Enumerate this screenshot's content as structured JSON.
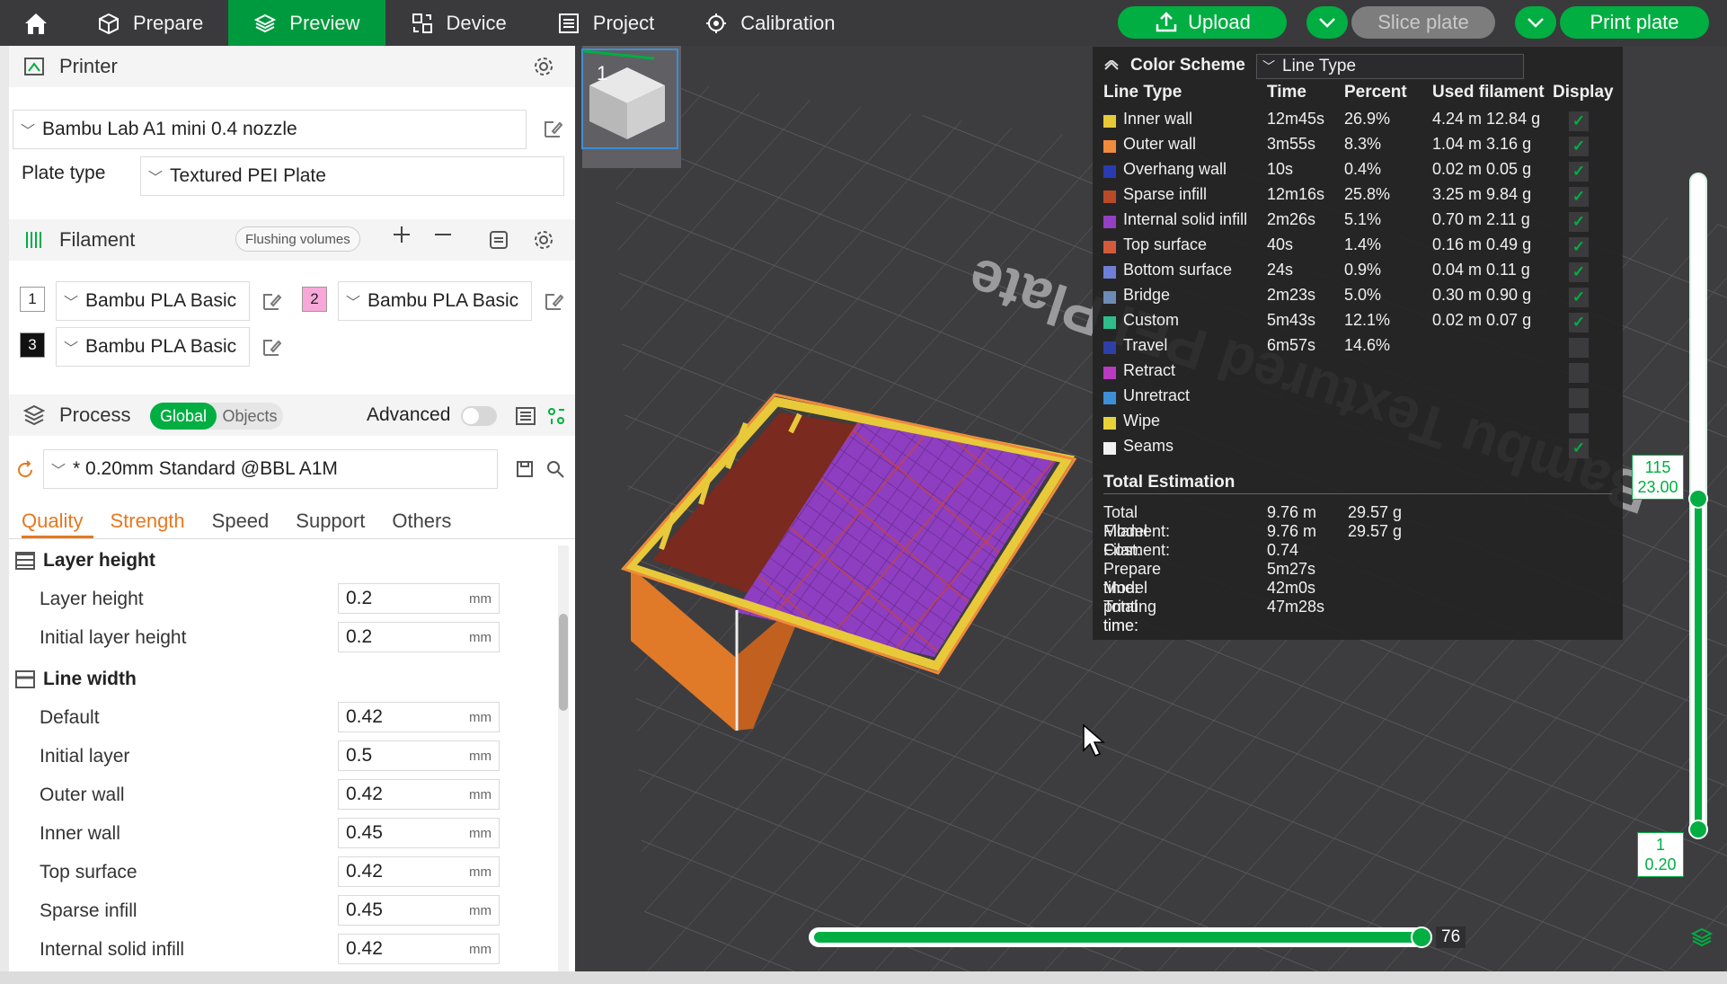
{
  "topbar": {
    "tabs": [
      {
        "label": "Prepare",
        "icon": "cube-icon"
      },
      {
        "label": "Preview",
        "icon": "layers-icon",
        "active": true
      },
      {
        "label": "Device",
        "icon": "device-icon"
      },
      {
        "label": "Project",
        "icon": "project-icon"
      },
      {
        "label": "Calibration",
        "icon": "calibration-icon"
      }
    ],
    "upload_label": "Upload",
    "slice_label": "Slice plate",
    "print_label": "Print plate"
  },
  "printer": {
    "title": "Printer",
    "name": "Bambu Lab A1 mini 0.4 nozzle",
    "plate_type_label": "Plate type",
    "plate_type_value": "Textured PEI Plate"
  },
  "filament": {
    "title": "Filament",
    "flushing_label": "Flushing volumes",
    "slots": [
      {
        "num": "1",
        "name": "Bambu PLA Basic",
        "color": "#ffffff",
        "text_color": "#222222"
      },
      {
        "num": "2",
        "name": "Bambu PLA Basic",
        "color": "#f7a8d8",
        "text_color": "#222222"
      },
      {
        "num": "3",
        "name": "Bambu PLA Basic",
        "color": "#111111",
        "text_color": "#ffffff"
      }
    ]
  },
  "process": {
    "title": "Process",
    "global_label": "Global",
    "objects_label": "Objects",
    "advanced_label": "Advanced",
    "preset": "* 0.20mm Standard @BBL A1M",
    "tabs": [
      "Quality",
      "Strength",
      "Speed",
      "Support",
      "Others"
    ],
    "groups": {
      "layer_height": {
        "title": "Layer height",
        "params": [
          {
            "label": "Layer height",
            "value": "0.2",
            "unit": "mm"
          },
          {
            "label": "Initial layer height",
            "value": "0.2",
            "unit": "mm"
          }
        ]
      },
      "line_width": {
        "title": "Line width",
        "params": [
          {
            "label": "Default",
            "value": "0.42",
            "unit": "mm"
          },
          {
            "label": "Initial layer",
            "value": "0.5",
            "unit": "mm"
          },
          {
            "label": "Outer wall",
            "value": "0.42",
            "unit": "mm"
          },
          {
            "label": "Inner wall",
            "value": "0.45",
            "unit": "mm"
          },
          {
            "label": "Top surface",
            "value": "0.42",
            "unit": "mm"
          },
          {
            "label": "Sparse infill",
            "value": "0.45",
            "unit": "mm"
          },
          {
            "label": "Internal solid infill",
            "value": "0.42",
            "unit": "mm"
          }
        ]
      }
    }
  },
  "viewport": {
    "plate_number": "1",
    "plate_text": "Bambu Textured PEI Plate",
    "legend": {
      "title": "Color Scheme",
      "scheme": "Line Type",
      "columns": [
        "Line Type",
        "Time",
        "Percent",
        "Used filament",
        "Display"
      ],
      "rows": [
        {
          "name": "Inner wall",
          "color": "#e8c93a",
          "time": "12m45s",
          "percent": "26.9%",
          "used": "4.24 m  12.84 g",
          "display": true
        },
        {
          "name": "Outer wall",
          "color": "#f08a3c",
          "time": "3m55s",
          "percent": "8.3%",
          "used": "1.04 m  3.16 g",
          "display": true
        },
        {
          "name": "Overhang wall",
          "color": "#2a3bb0",
          "time": "10s",
          "percent": "0.4%",
          "used": "0.02 m  0.05 g",
          "display": true
        },
        {
          "name": "Sparse infill",
          "color": "#b84a28",
          "time": "12m16s",
          "percent": "25.8%",
          "used": "3.25 m  9.84 g",
          "display": true
        },
        {
          "name": "Internal solid infill",
          "color": "#9440c2",
          "time": "2m26s",
          "percent": "5.1%",
          "used": "0.70 m  2.11 g",
          "display": true
        },
        {
          "name": "Top surface",
          "color": "#d35a3a",
          "time": "40s",
          "percent": "1.4%",
          "used": "0.16 m  0.49 g",
          "display": true
        },
        {
          "name": "Bottom surface",
          "color": "#6f7fd8",
          "time": "24s",
          "percent": "0.9%",
          "used": "0.04 m  0.11 g",
          "display": true
        },
        {
          "name": "Bridge",
          "color": "#6c8bb5",
          "time": "2m23s",
          "percent": "5.0%",
          "used": "0.30 m  0.90 g",
          "display": true
        },
        {
          "name": "Custom",
          "color": "#2ebd8a",
          "time": "5m43s",
          "percent": "12.1%",
          "used": "0.02 m  0.07 g",
          "display": true
        },
        {
          "name": "Travel",
          "color": "#2f3fa8",
          "time": "6m57s",
          "percent": "14.6%",
          "used": "",
          "display": false
        },
        {
          "name": "Retract",
          "color": "#b83bc0",
          "time": "",
          "percent": "",
          "used": "",
          "display": false
        },
        {
          "name": "Unretract",
          "color": "#3d8fd6",
          "time": "",
          "percent": "",
          "used": "",
          "display": false
        },
        {
          "name": "Wipe",
          "color": "#e8d23a",
          "time": "",
          "percent": "",
          "used": "",
          "display": false
        },
        {
          "name": "Seams",
          "color": "#f2f2f2",
          "time": "",
          "percent": "",
          "used": "",
          "display": true
        }
      ],
      "total_title": "Total Estimation",
      "totals": [
        {
          "key": "Total Filament:",
          "v1": "9.76 m",
          "v2": "29.57 g"
        },
        {
          "key": "Model Filament:",
          "v1": "9.76 m",
          "v2": "29.57 g"
        },
        {
          "key": "Cost:",
          "v1": "0.74",
          "v2": ""
        },
        {
          "key": "Prepare time:",
          "v1": "5m27s",
          "v2": ""
        },
        {
          "key": "Model printing time:",
          "v1": "42m0s",
          "v2": ""
        },
        {
          "key": "Total time:",
          "v1": "47m28s",
          "v2": ""
        }
      ]
    },
    "vslider": {
      "top_layer": "115",
      "top_height": "23.00",
      "bottom_layer": "1",
      "bottom_height": "0.20"
    },
    "hslider": {
      "value": "76"
    }
  }
}
